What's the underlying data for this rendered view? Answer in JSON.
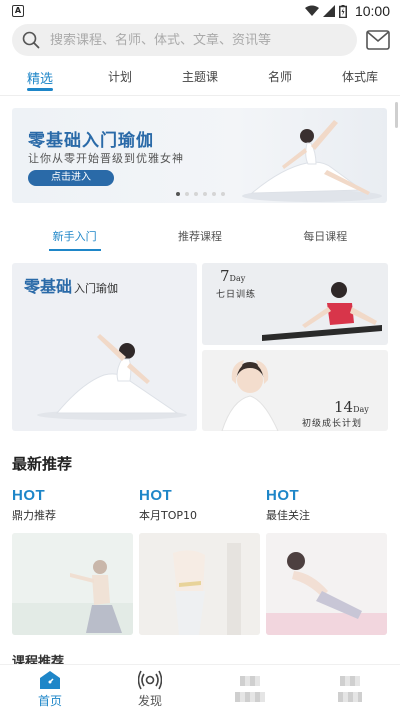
{
  "status_bar": {
    "time": "10:00"
  },
  "search": {
    "placeholder": "搜索课程、名师、体式、文章、资讯等"
  },
  "top_tabs": [
    {
      "label": "精选",
      "active": true
    },
    {
      "label": "计划",
      "active": false
    },
    {
      "label": "主题课",
      "active": false
    },
    {
      "label": "名师",
      "active": false
    },
    {
      "label": "体式库",
      "active": false
    }
  ],
  "banner": {
    "title": "零基础入门瑜伽",
    "subtitle": "让你从零开始晋级到优雅女神",
    "button": "点击进入",
    "pages": 6,
    "active_page": 1
  },
  "sub_tabs": [
    {
      "label": "新手入门",
      "active": true
    },
    {
      "label": "推荐课程",
      "active": false
    },
    {
      "label": "每日课程",
      "active": false
    }
  ],
  "cards": {
    "big": {
      "title_main": "零基础",
      "title_rest": "入门瑜伽"
    },
    "seven_day": {
      "number": "7",
      "unit": "Day",
      "caption": "七日训练"
    },
    "fourteen_day": {
      "number": "14",
      "unit": "Day",
      "caption": "初级成长计划"
    }
  },
  "latest": {
    "title": "最新推荐",
    "items": [
      {
        "tag": "HOT",
        "label": "鼎力推荐"
      },
      {
        "tag": "HOT",
        "label": "本月TOP10"
      },
      {
        "tag": "HOT",
        "label": "最佳关注"
      }
    ]
  },
  "next_section": {
    "title": "课程推荐"
  },
  "bottom_nav": [
    {
      "label": "首页",
      "icon": "home-icon",
      "active": true
    },
    {
      "label": "发现",
      "icon": "discover-icon",
      "active": false
    }
  ],
  "colors": {
    "accent": "#1e86c8",
    "banner_title": "#2a6aa8"
  }
}
